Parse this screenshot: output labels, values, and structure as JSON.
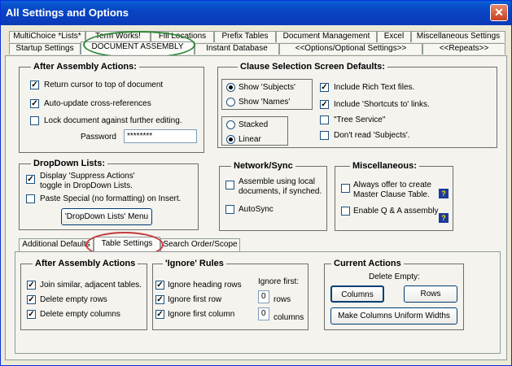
{
  "window": {
    "title": "All Settings and Options",
    "close_symbol": "✕"
  },
  "top_tabs_row1": [
    "MultiChoice *Lists*",
    "Term Works!",
    "Fill Locations",
    "Prefix Tables",
    "Document Management",
    "Excel",
    "Miscellaneous Settings"
  ],
  "top_tabs_row2": [
    "Startup Settings",
    "DOCUMENT ASSEMBLY",
    "Instant Database",
    "<<Options/Optional Settings>>",
    "<<Repeats>>"
  ],
  "after_assembly": {
    "title": "After Assembly Actions:",
    "items": [
      {
        "label": "Return cursor to top of document",
        "checked": true
      },
      {
        "label": "Auto-update cross-references",
        "checked": true
      },
      {
        "label": "Lock document against further editing.",
        "checked": false
      }
    ],
    "password_label": "Password",
    "password_value": "********"
  },
  "clause_selection": {
    "title": "Clause Selection Screen Defaults:",
    "radio_show": [
      {
        "label": "Show 'Subjects'",
        "selected": true
      },
      {
        "label": "Show 'Names'",
        "selected": false
      }
    ],
    "radio_layout": [
      {
        "label": "Stacked",
        "selected": false
      },
      {
        "label": "Linear",
        "selected": true
      }
    ],
    "checks": [
      {
        "label": "Include Rich Text files.",
        "checked": true
      },
      {
        "label": "Include 'Shortcuts to' links.",
        "checked": true
      },
      {
        "label": "\"Tree Service\"",
        "checked": false
      },
      {
        "label": "Don't read 'Subjects'.",
        "checked": false
      }
    ]
  },
  "dropdown_lists": {
    "title": "DropDown Lists:",
    "items": [
      {
        "label_line1": "Display 'Suppress Actions'",
        "label_line2": "toggle in DropDown Lists.",
        "checked": true
      },
      {
        "label_line1": "Paste Special (no formatting) on Insert.",
        "label_line2": "",
        "checked": false
      }
    ],
    "menu_button": "'DropDown Lists' Menu"
  },
  "network_sync": {
    "title": "Network/Sync",
    "items": [
      {
        "label_line1": "Assemble using local",
        "label_line2": "documents, if synched.",
        "checked": false
      },
      {
        "label_line1": "AutoSync",
        "label_line2": "",
        "checked": false
      }
    ]
  },
  "miscellaneous": {
    "title": "Miscellaneous:",
    "items": [
      {
        "label_line1": "Always offer to create",
        "label_line2": "Master Clause Table.",
        "checked": false
      },
      {
        "label_line1": "Enable Q & A assembly",
        "label_line2": "",
        "checked": false
      }
    ],
    "help_symbol": "?"
  },
  "inner_tabs": [
    "Additional Defaults",
    "Table Settings",
    "Search Order/Scope"
  ],
  "table_after_assembly": {
    "title": "After Assembly Actions",
    "items": [
      {
        "label": "Join similar, adjacent tables.",
        "checked": true
      },
      {
        "label": "Delete empty rows",
        "checked": true
      },
      {
        "label": "Delete empty columns",
        "checked": true
      }
    ]
  },
  "ignore_rules": {
    "title": "'Ignore' Rules",
    "items": [
      {
        "label": "Ignore heading rows",
        "checked": true
      },
      {
        "label": "Ignore first row",
        "checked": true
      },
      {
        "label": "Ignore first column",
        "checked": true
      }
    ],
    "ignore_first_label": "Ignore first:",
    "rows_value": "0",
    "rows_label": "rows",
    "columns_value": "0",
    "columns_label": "columns"
  },
  "current_actions": {
    "title": "Current Actions",
    "delete_empty_label": "Delete Empty:",
    "columns_button": "Columns",
    "rows_button": "Rows",
    "uniform_button": "Make Columns Uniform Widths"
  },
  "check_mark": "✓",
  "colors": {
    "title_bar": "#0a5fd8",
    "annotation_green": "#2f8a3a",
    "annotation_red": "#c23a3a"
  }
}
